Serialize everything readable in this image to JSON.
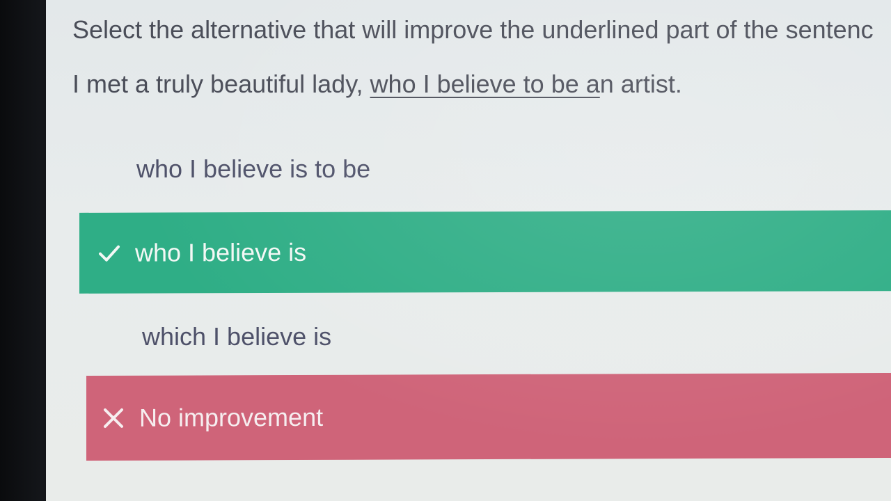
{
  "question": {
    "prompt": "Select the alternative that will improve the underlined part of the sentenc",
    "sentence_before": "I met a truly beautiful lady, ",
    "sentence_underlined": "who I believe to be a",
    "sentence_after": "n artist."
  },
  "options": [
    {
      "label": "who I believe is to be",
      "state": "unselected"
    },
    {
      "label": "who I believe is",
      "state": "correct",
      "icon": "checkmark-icon"
    },
    {
      "label": "which I believe is",
      "state": "unselected"
    },
    {
      "label": "No improvement",
      "state": "incorrect",
      "icon": "x-icon"
    }
  ],
  "colors": {
    "correct": "#2fae86",
    "incorrect": "#cf6479",
    "text": "#4a4d58",
    "background": "#e7ebeb"
  }
}
